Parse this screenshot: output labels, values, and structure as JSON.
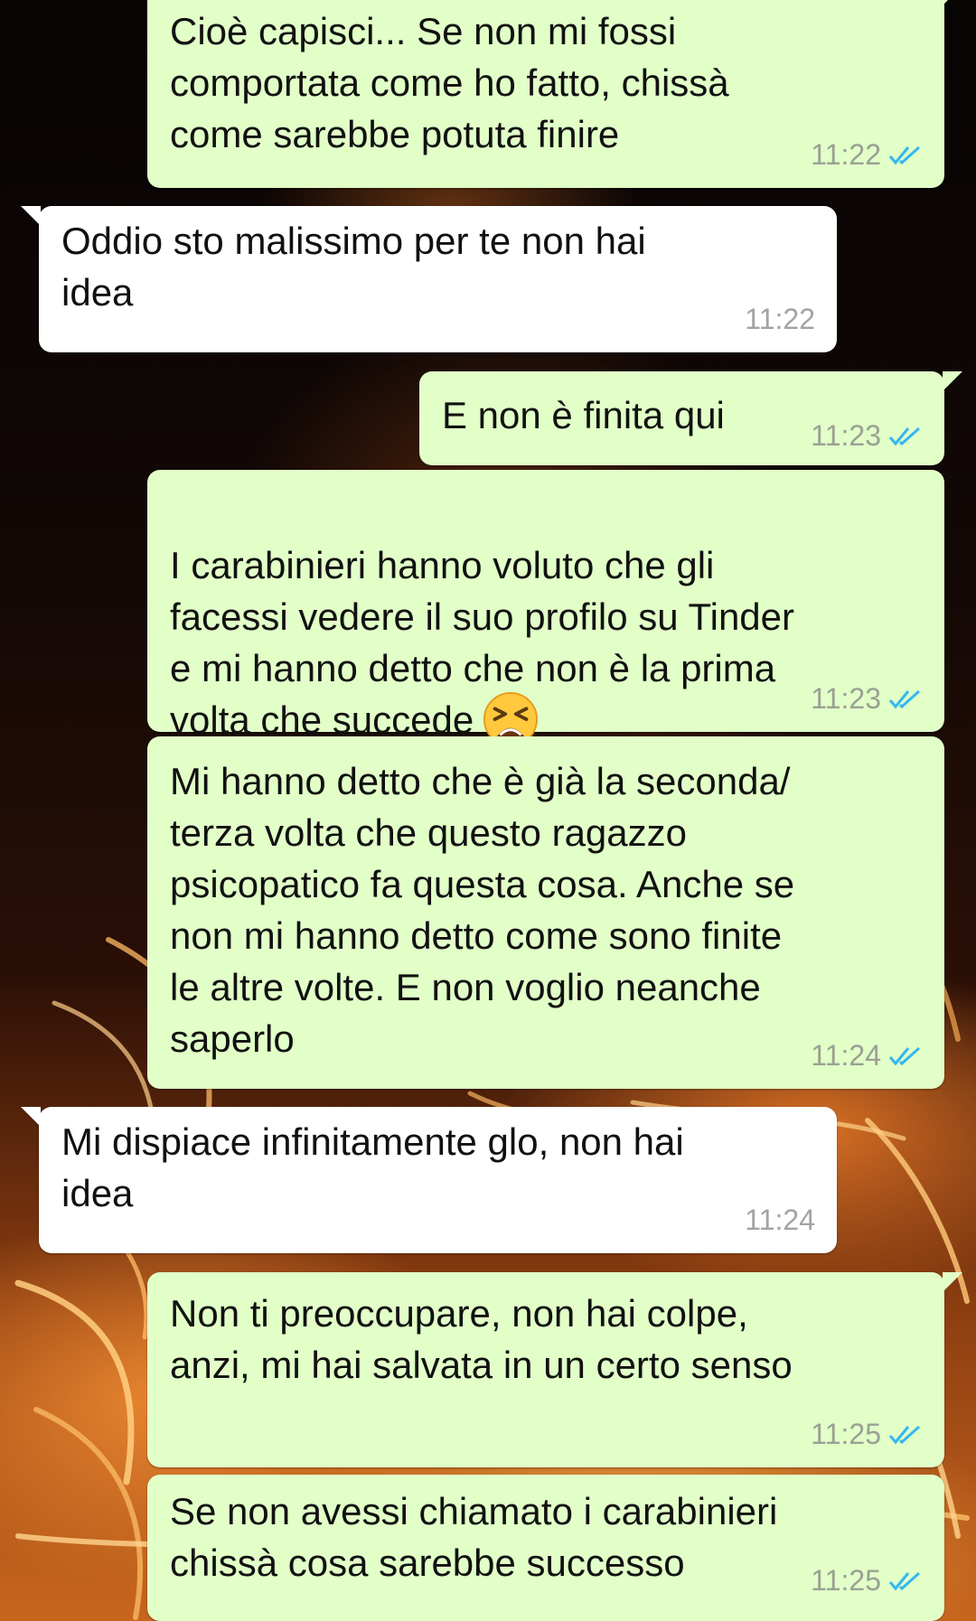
{
  "colors": {
    "outgoing_bubble": "#e2ffc8",
    "incoming_bubble": "#ffffff",
    "read_ticks": "#34b7f1",
    "timestamp": "#9aa093"
  },
  "messages": [
    {
      "direction": "outgoing",
      "text": "Cioè capisci... Se non mi fossi\ncomportata come ho fatto, chissà\ncome sarebbe potuta finire",
      "time": "11:22",
      "status": "read"
    },
    {
      "direction": "incoming",
      "text": "Oddio sto malissimo per te non hai\nidea",
      "time": "11:22"
    },
    {
      "direction": "outgoing",
      "text": "E non è finita qui",
      "time": "11:23",
      "status": "read"
    },
    {
      "direction": "outgoing",
      "text": "I carabinieri hanno voluto che gli\nfacessi vedere il suo profilo su Tinder\ne mi hanno detto che non è la prima\nvolta che succede",
      "emoji": "tired-face-emoji",
      "time": "11:23",
      "status": "read"
    },
    {
      "direction": "outgoing",
      "text": "Mi hanno detto che è già la seconda/\nterza volta che questo ragazzo\npsicopatico fa questa cosa. Anche se\nnon mi hanno detto come sono finite\nle altre volte. E non voglio neanche\nsaperlo",
      "time": "11:24",
      "status": "read"
    },
    {
      "direction": "incoming",
      "text": "Mi dispiace infinitamente glo, non hai\nidea",
      "time": "11:24"
    },
    {
      "direction": "outgoing",
      "text": "Non ti preoccupare, non hai colpe,\nanzi, mi hai salvata in un certo senso",
      "time": "11:25",
      "status": "read"
    },
    {
      "direction": "outgoing",
      "text": "Se non avessi chiamato i carabinieri\nchissà cosa sarebbe successo",
      "time": "11:25",
      "status": "read"
    }
  ]
}
